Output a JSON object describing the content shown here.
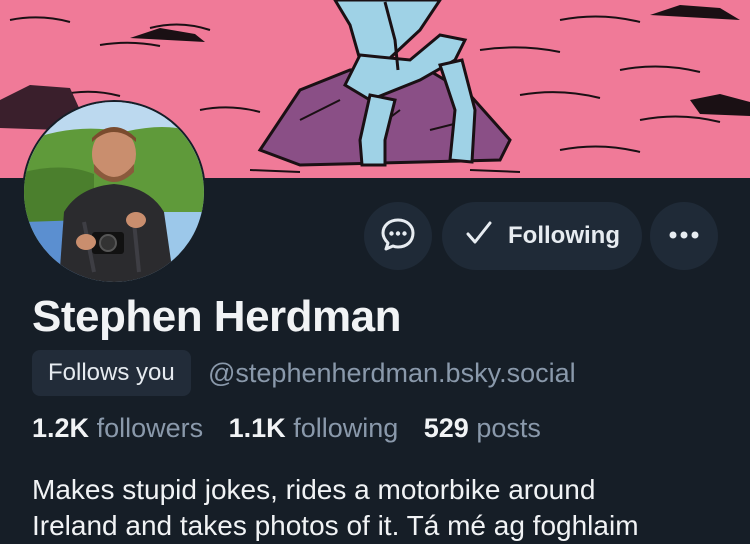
{
  "profile": {
    "display_name": "Stephen Herdman",
    "follows_you_label": "Follows you",
    "handle": "@stephenherdman.bsky.social",
    "bio_line1": "Makes stupid jokes, rides a motorbike around",
    "bio_line2": "Ireland and takes photos of it. Tá mé ag foghlaim"
  },
  "actions": {
    "message_icon": "chat-bubble-icon",
    "following_label": "Following",
    "following_icon": "check-icon",
    "more_icon": "ellipsis-icon"
  },
  "stats": {
    "followers_count": "1.2K",
    "followers_label": "followers",
    "following_count": "1.1K",
    "following_label": "following",
    "posts_count": "529",
    "posts_label": "posts"
  },
  "colors": {
    "background": "#161e27",
    "banner_pink": "#f07a98",
    "button_bg": "#1f2a37",
    "muted_text": "#8a99ab"
  }
}
